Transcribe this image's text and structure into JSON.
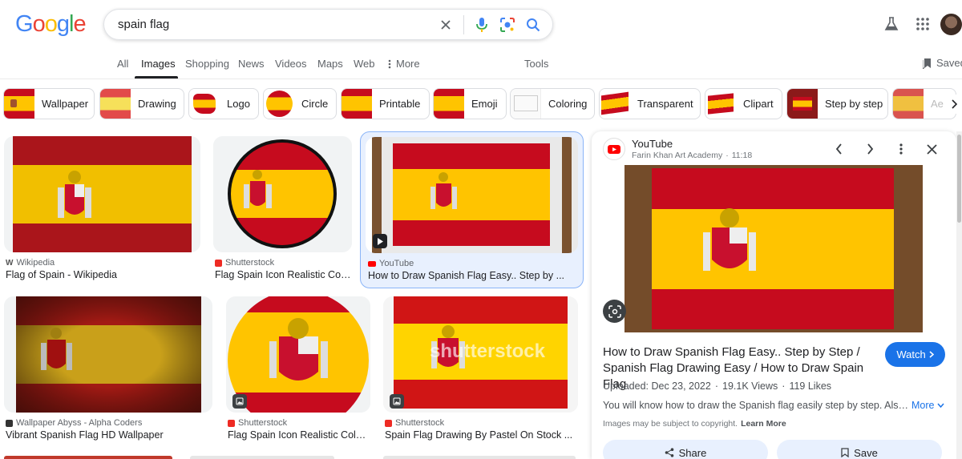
{
  "header": {
    "logo_letters": [
      "G",
      "o",
      "o",
      "g",
      "l",
      "e"
    ],
    "search_query": "spain flag"
  },
  "tabs": [
    {
      "label": "All"
    },
    {
      "label": "Images"
    },
    {
      "label": "Shopping"
    },
    {
      "label": "News"
    },
    {
      "label": "Videos"
    },
    {
      "label": "Maps"
    },
    {
      "label": "Web"
    },
    {
      "label": "More"
    },
    {
      "label": "Tools"
    }
  ],
  "saved_label": "Saved",
  "chips": [
    {
      "label": "Wallpaper"
    },
    {
      "label": "Drawing"
    },
    {
      "label": "Logo"
    },
    {
      "label": "Circle"
    },
    {
      "label": "Printable"
    },
    {
      "label": "Emoji"
    },
    {
      "label": "Coloring"
    },
    {
      "label": "Transparent"
    },
    {
      "label": "Clipart"
    },
    {
      "label": "Step by step"
    },
    {
      "label": "Ae"
    }
  ],
  "results": [
    {
      "source": "Wikipedia",
      "title": "Flag of Spain - Wikipedia"
    },
    {
      "source": "Shutterstock",
      "title": "Flag Spain Icon Realistic Col..."
    },
    {
      "source": "YouTube",
      "title": "How to Draw Spanish Flag Easy.. Step by ..."
    },
    {
      "source": "Wallpaper Abyss - Alpha Coders",
      "title": "Vibrant Spanish Flag HD Wallpaper"
    },
    {
      "source": "Shutterstock",
      "title": "Flag Spain Icon Realistic Color ..."
    },
    {
      "source": "Shutterstock",
      "title": "Spain Flag Drawing By Pastel On Stock ..."
    }
  ],
  "watermark": "shutterstock",
  "panel": {
    "site": "YouTube",
    "channel": "Farin Khan Art Academy",
    "duration": "11:18",
    "title_line1": "How to Draw Spanish Flag Easy.. Step by Step /",
    "title_line2": "Spanish Flag Drawing Easy / How to Draw Spain Flag",
    "watch_label": "Watch",
    "uploaded": "Uploaded: Dec 23, 2022",
    "views": "19.1K Views",
    "likes": "119 Likes",
    "description": "You will know how to draw the Spanish flag easily step by step. Also learn...",
    "more_label": "More",
    "copyright_text": "Images may be subject to copyright.",
    "learn_more": "Learn More",
    "share_label": "Share",
    "save_label": "Save"
  },
  "colors": {
    "flag_red": "#c60b1e",
    "flag_yellow": "#ffc400",
    "accent_blue": "#1a73e8",
    "selected_bg": "#e8f0fe",
    "youtube_red": "#ff0000"
  }
}
